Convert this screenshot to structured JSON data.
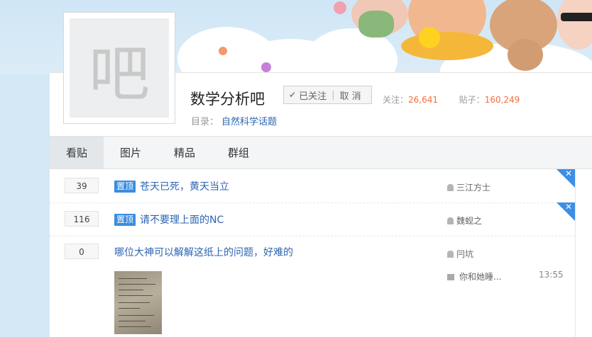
{
  "forum": {
    "avatar_char": "吧",
    "name": "数学分析吧",
    "follow_label": "已关注",
    "unfollow_label": "取 消",
    "stats": {
      "follow_label": "关注：",
      "follow_count": "26,641",
      "posts_label": "贴子：",
      "posts_count": "160,249"
    },
    "directory_label": "目录：",
    "directory_value": "自然科学话题"
  },
  "tabs": [
    {
      "label": "看贴",
      "active": true
    },
    {
      "label": "图片",
      "active": false
    },
    {
      "label": "精品",
      "active": false
    },
    {
      "label": "群组",
      "active": false
    }
  ],
  "threads": [
    {
      "replies": "39",
      "badge": "置顶",
      "title": "苍天已死，黄天当立",
      "author": "三江方士",
      "corner_icon": "close-icon"
    },
    {
      "replies": "116",
      "badge": "置顶",
      "title": "请不要理上面的NC",
      "author": "魏蚬之",
      "corner_icon": "close-icon"
    },
    {
      "replies": "0",
      "badge": "",
      "title": "哪位大神可以解解这纸上的问题，好难的",
      "author": "冃坑",
      "last_reply_user": "你和她睡...",
      "last_reply_time": "13:55"
    }
  ],
  "colors": {
    "accent": "#3b8de0",
    "link": "#2d64b3",
    "stat_number": "#f26f3d"
  }
}
